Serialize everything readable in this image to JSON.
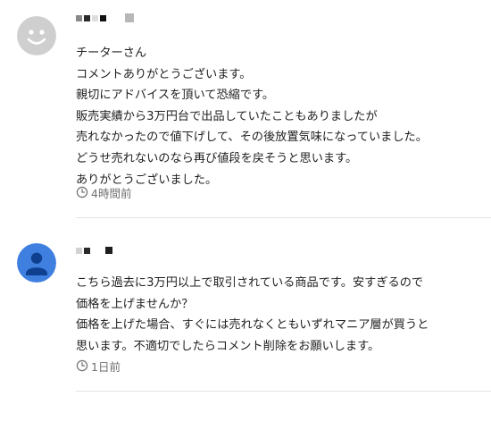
{
  "comments": [
    {
      "author_name_masked": "",
      "body": "チーターさん\nコメントありがとうございます。\n親切にアドバイスを頂いて恐縮です。\n販売実績から3万円台で出品していたこともありましたが\n売れなかったので値下げして、その後放置気味になっていました。\nどうせ売れないのなら再び値段を戻そうと思います。\nありがとうございました。",
      "time": "4時間前",
      "avatar_icon": "smiley-face-avatar",
      "avatar_color": "#cfcfcf"
    },
    {
      "author_name_masked": "",
      "body": "こちら過去に3万円以上で取引されている商品です。安すぎるので\n価格を上げませんか？\n価格を上げた場合、すぐには売れなくともいずれマニア層が買うと\n思います。不適切でしたらコメント削除をお願いします。",
      "time": "1日前",
      "avatar_icon": "person-avatar",
      "avatar_color": "#3f7fe0"
    }
  ],
  "colors": {
    "text": "#1f1f1f",
    "meta": "#707070",
    "divider": "#e3e3e3"
  }
}
